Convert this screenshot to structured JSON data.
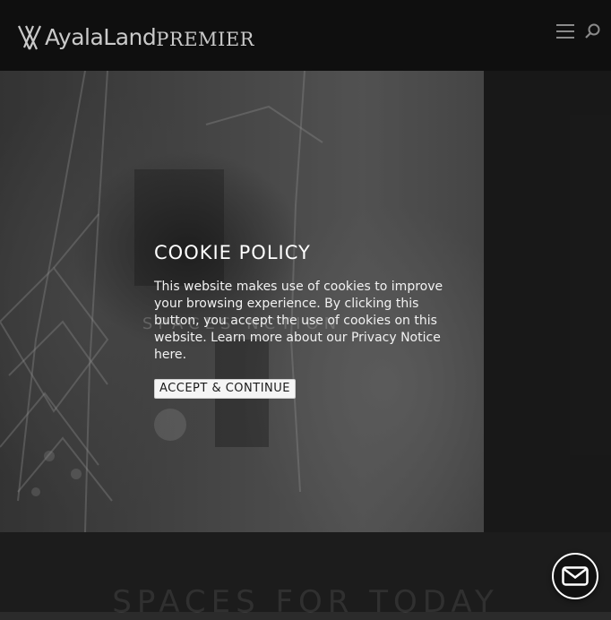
{
  "header": {
    "logo": {
      "main": "AyalaLand",
      "sub": "PREMIER"
    },
    "menu_icon": "hamburger-menu-icon",
    "search_icon": "search-icon"
  },
  "hero": {
    "title": "SPACES          NCTION"
  },
  "section": {
    "title": "SPACES FOR TODAY"
  },
  "cookie": {
    "title": "COOKIE POLICY",
    "text_1": "This website makes use of cookies to improve your browsing experience. By clicking this button, you accept the use of cookies on this website.",
    "text_2": "Learn more about our ",
    "privacy_link": "Privacy Notice",
    "text_3": " ",
    "here_link": "here",
    "text_4": ".",
    "button": "ACCEPT & CONTINUE"
  },
  "chat": {
    "icon": "envelope-icon"
  },
  "colors": {
    "header_bg": "#0f0f0f",
    "page_bg": "#2b2b2b",
    "button_bg": "#f5f5f5"
  }
}
